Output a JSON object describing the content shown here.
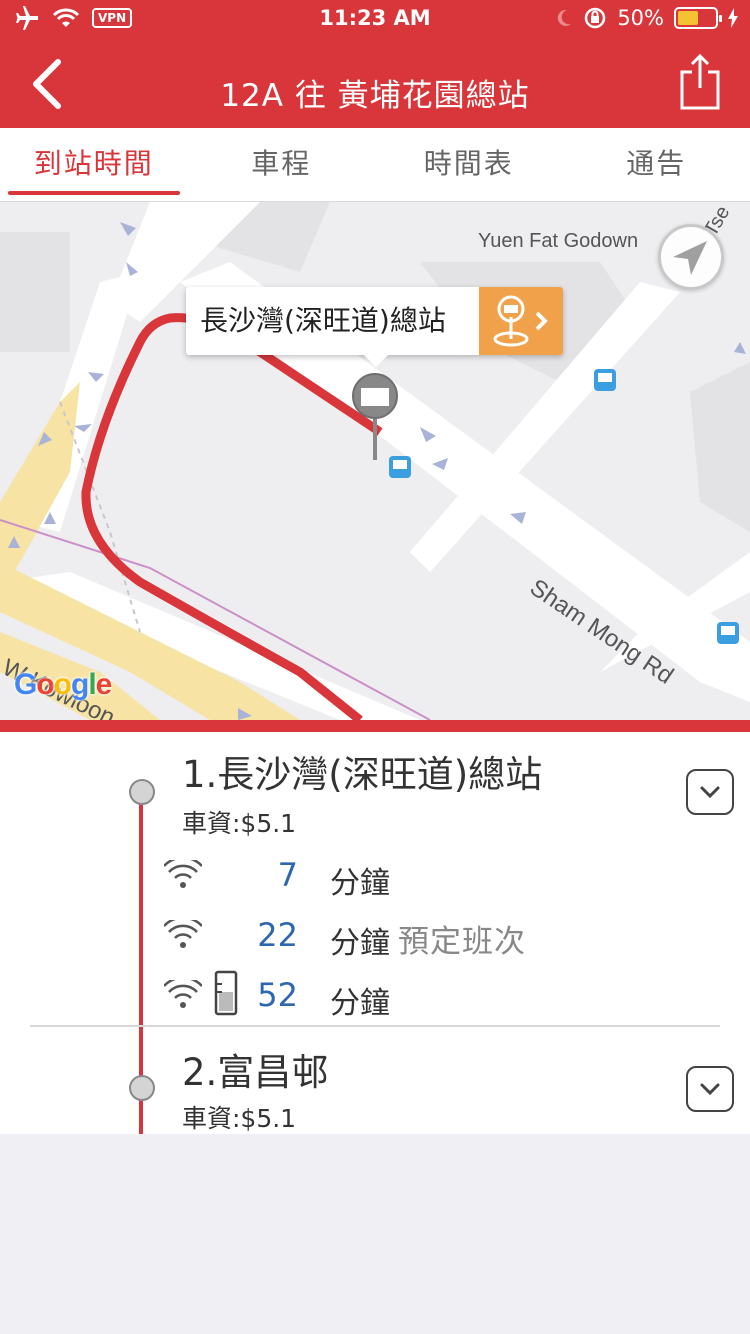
{
  "status": {
    "time": "11:23 AM",
    "vpn": "VPN",
    "battery": "50%"
  },
  "nav": {
    "title": "12A 往 黃埔花園總站"
  },
  "tabs": [
    {
      "label": "到站時間",
      "active": true
    },
    {
      "label": "車程",
      "active": false
    },
    {
      "label": "時間表",
      "active": false
    },
    {
      "label": "通告",
      "active": false
    }
  ],
  "map": {
    "callout_text": "長沙灣(深旺道)總站",
    "labels": {
      "godown": "Yuen Fat Godown",
      "road": "Sham Mong Rd",
      "road2": "W Kowloon",
      "tse": "Tse"
    },
    "logo": "Google"
  },
  "stops": [
    {
      "name": "1.長沙灣(深旺道)總站",
      "fare": "車資:$5.1",
      "etas": [
        {
          "minutes": "7",
          "unit": "分鐘",
          "note": ""
        },
        {
          "minutes": "22",
          "unit": "分鐘",
          "note": "預定班次"
        },
        {
          "minutes": "52",
          "unit": "分鐘",
          "note": ""
        }
      ]
    },
    {
      "name": "2.富昌邨",
      "fare": "車資:$5.1"
    }
  ],
  "colors": {
    "brand_red": "#d8363a",
    "eta_blue": "#2d67b1",
    "callout_orange": "#f0a14a"
  }
}
